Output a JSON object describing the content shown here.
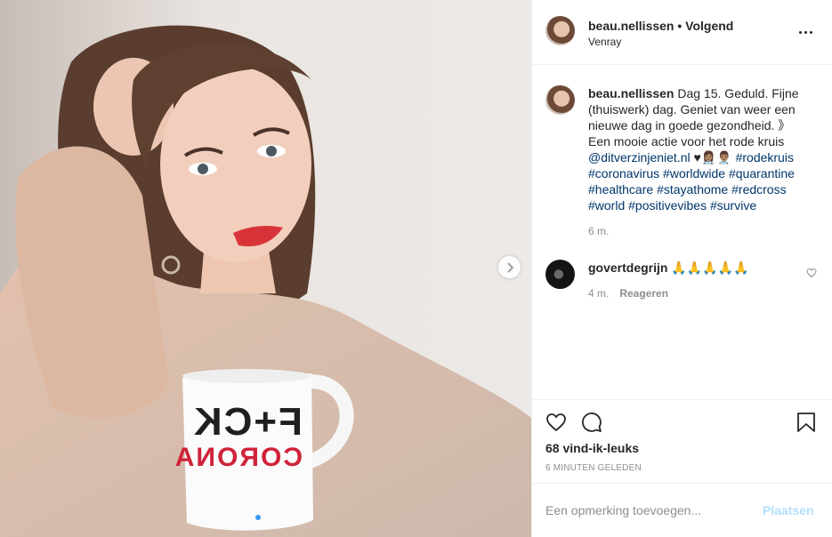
{
  "post": {
    "author": {
      "username": "beau.nellissen",
      "separator": "•",
      "follow_status": "Volgend",
      "location": "Venray"
    },
    "caption": {
      "username": "beau.nellissen",
      "text": "Dag 15. Geduld. Fijne (thuiswerk) dag. Geniet van weer een nieuwe dag in goede gezondheid. 》Een mooie actie voor het rode kruis",
      "mention": "@ditverzinjeniet.nl",
      "emojis": "♥👩🏽‍⚕️👨🏽‍⚕️",
      "hashtags": [
        "#rodekruis",
        "#coronavirus",
        "#worldwide",
        "#quarantine",
        "#healthcare",
        "#stayathome",
        "#redcross",
        "#world",
        "#positivevibes",
        "#survive"
      ],
      "time": "6 m."
    },
    "comments": [
      {
        "username": "govertdegrijn",
        "text": "🙏🙏🙏🙏🙏",
        "time": "4 m.",
        "reply_label": "Reageren"
      }
    ],
    "mug_text": {
      "line1": "F+CK",
      "line2": "CORONA"
    },
    "carousel": {
      "current": 1,
      "total": 2
    },
    "likes": "68 vind-ik-leuks",
    "time_ago": "6 MINUTEN GELEDEN",
    "comment_input": {
      "placeholder": "Een opmerking toevoegen...",
      "value": ""
    },
    "post_button": "Plaatsen",
    "icons": [
      "more-options-icon",
      "heart-icon",
      "comment-icon",
      "bookmark-icon",
      "chevron-right-icon",
      "small-heart-icon"
    ],
    "colors": {
      "link": "#003569",
      "accent": "#3897f0",
      "post_button_disabled": "#b2dffc",
      "muted": "#8e8e8e"
    }
  }
}
